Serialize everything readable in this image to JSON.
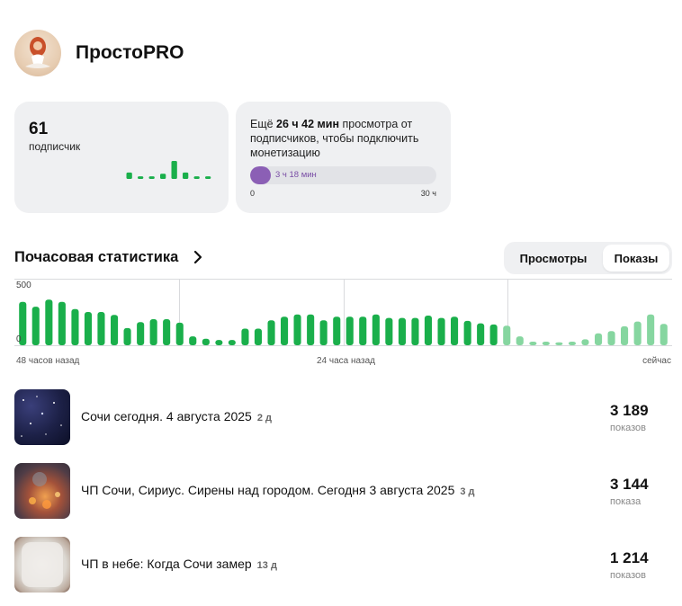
{
  "channel": {
    "name": "ПростоPRO"
  },
  "subscribers": {
    "count": "61",
    "label": "подписчик",
    "mini_bars": [
      5,
      2,
      2,
      4,
      14,
      5,
      2,
      2
    ]
  },
  "monetization": {
    "text_before": "Ещё ",
    "remaining": "26 ч 42 мин",
    "text_after": " просмотра от подписчиков, чтобы подключить монетизацию",
    "progress_label": "3 ч 18 мин",
    "progress_fraction": 0.11,
    "min_label": "0",
    "max_label": "30 ч",
    "accent_color": "#8b5fb5"
  },
  "section": {
    "title": "Почасовая статистика",
    "chevron_icon": "chevron-right-icon"
  },
  "toggle": {
    "views_label": "Просмотры",
    "impressions_label": "Показы",
    "active": "impressions"
  },
  "chart_data": {
    "type": "bar",
    "ylim": [
      0,
      500
    ],
    "y_ticks": [
      "500",
      "0"
    ],
    "x_tick_labels": [
      "48 часов назад",
      "24 часа назад",
      "сейчас"
    ],
    "colors": {
      "past": "#1aaf4b",
      "recent": "#86d6a0"
    },
    "recent_from_index": 37,
    "values": [
      365,
      325,
      385,
      365,
      305,
      280,
      280,
      255,
      145,
      195,
      220,
      220,
      190,
      75,
      55,
      45,
      45,
      140,
      140,
      210,
      240,
      260,
      260,
      210,
      240,
      240,
      240,
      260,
      230,
      230,
      230,
      250,
      230,
      240,
      205,
      185,
      175,
      165,
      75,
      30,
      30,
      25,
      30,
      50,
      100,
      120,
      160,
      200,
      260,
      180
    ]
  },
  "videos": [
    {
      "title": "Сочи сегодня. 4 августа 2025",
      "age": "2 д",
      "count": "3 189",
      "unit": "показов"
    },
    {
      "title": "ЧП Сочи, Сириус. Сирены над городом. Сегодня 3 августа 2025",
      "age": "3 д",
      "count": "3 144",
      "unit": "показа"
    },
    {
      "title": "ЧП в небе: Когда Сочи замер",
      "age": "13 д",
      "count": "1 214",
      "unit": "показов"
    }
  ]
}
